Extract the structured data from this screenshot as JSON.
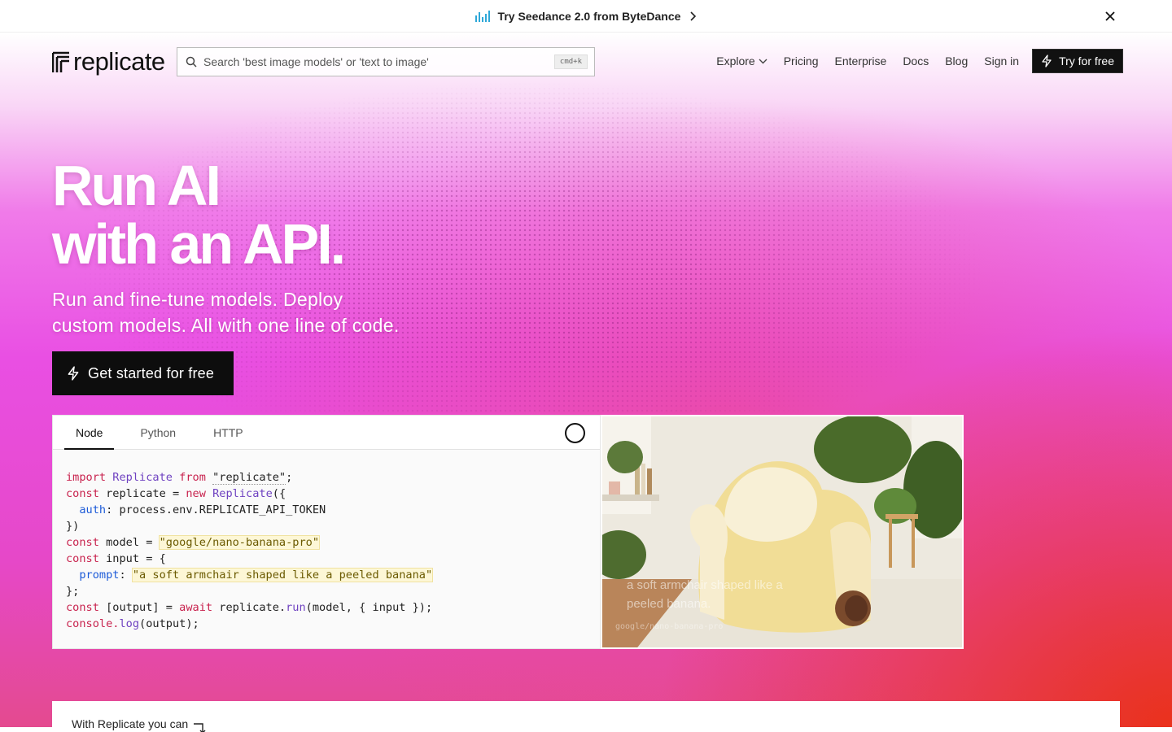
{
  "banner": {
    "text": "Try Seedance 2.0 from ByteDance",
    "icon": "audio-bars-icon",
    "chevron_icon": "chevron-right-icon",
    "close_icon": "close-icon"
  },
  "header": {
    "logo_text": "replicate",
    "search": {
      "placeholder": "Search 'best image models' or 'text to image'",
      "shortcut": "cmd+k"
    },
    "nav": {
      "explore": "Explore",
      "pricing": "Pricing",
      "enterprise": "Enterprise",
      "docs": "Docs",
      "blog": "Blog",
      "sign_in": "Sign in",
      "try_free": "Try for free"
    }
  },
  "hero": {
    "headline_line1": "Run AI",
    "headline_line2": "with an API.",
    "subhead_line1": "Run and fine-tune models. Deploy",
    "subhead_line2": "custom models. All with one line of code.",
    "cta": "Get started for free"
  },
  "code_panel": {
    "tabs": [
      "Node",
      "Python",
      "HTTP"
    ],
    "active_tab": "Node",
    "model": "google/nano-banana-pro",
    "prompt": "a soft armchair shaped like a peeled banana",
    "lines": {
      "l1_a": "import",
      "l1_b": "Replicate",
      "l1_c": "from",
      "l1_d": "\"replicate\"",
      "l2_a": "const",
      "l2_b": "replicate",
      "l2_c": "new",
      "l2_d": "Replicate",
      "l3_a": "auth",
      "l3_b": "process.env.REPLICATE_API_TOKEN",
      "l4": "})",
      "l5_a": "const",
      "l5_b": "model",
      "l6_a": "const",
      "l6_b": "input",
      "l7_a": "prompt",
      "l8": "};",
      "l9_a": "const",
      "l9_b": "[output]",
      "l9_c": "await",
      "l9_d": "replicate.",
      "l9_e": "run",
      "l9_f": "(model, { input });",
      "l10_a": "console.",
      "l10_b": "log",
      "l10_c": "(output);"
    }
  },
  "image_panel": {
    "caption": "a soft armchair shaped like a peeled banana.",
    "model_label": "google/nano-banana-pro"
  },
  "bottom": {
    "text": "With Replicate you can",
    "icon": "arrow-turn-down-icon"
  },
  "colors": {
    "accent_dark": "#0d0d0d",
    "hero_pink": "#e94fe3",
    "hero_red": "#ea3016",
    "code_keyword": "#c8234e",
    "code_class": "#6f42c1",
    "code_property": "#1d5bd8"
  }
}
